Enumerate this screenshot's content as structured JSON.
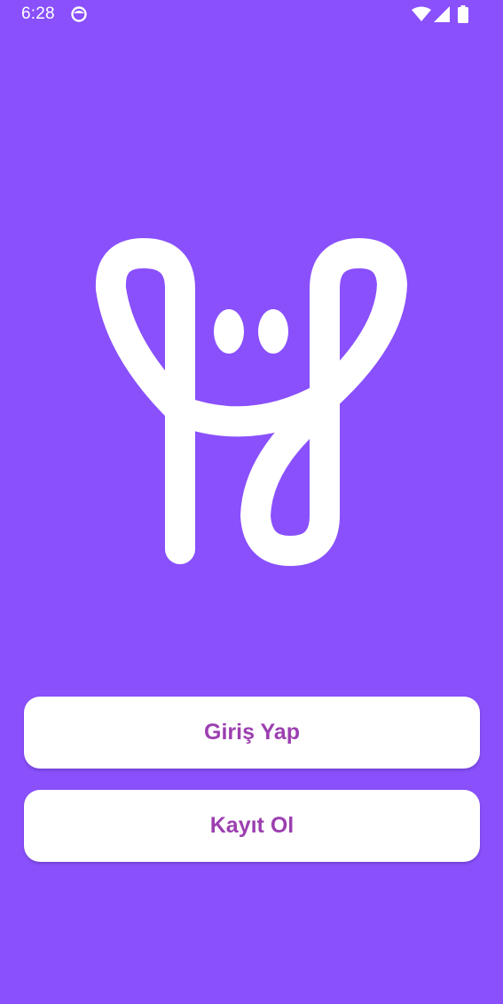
{
  "status_bar": {
    "time": "6:28",
    "icons": [
      "app-notification-icon",
      "wifi-icon",
      "signal-icon",
      "battery-icon"
    ]
  },
  "logo": {
    "icon": "smiling-face-logo-icon",
    "color": "#ffffff"
  },
  "buttons": {
    "login_label": "Giriş Yap",
    "register_label": "Kayıt Ol"
  },
  "colors": {
    "background": "#8950fc",
    "button_background": "#ffffff",
    "button_text": "#9c3fb0"
  }
}
